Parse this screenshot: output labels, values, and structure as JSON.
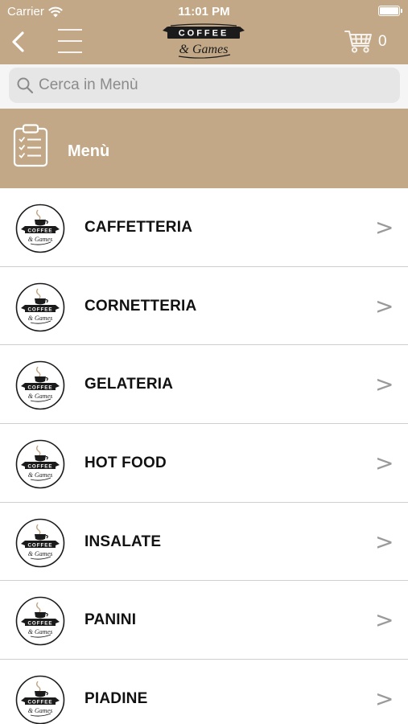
{
  "status_bar": {
    "carrier": "Carrier",
    "time": "11:01 PM",
    "battery_level": 1.0
  },
  "nav": {
    "back_icon": "chevron-left-icon",
    "menu_icon": "hamburger-icon",
    "logo": {
      "line1": "COFFEE",
      "line2": "& Games"
    },
    "cart_icon": "cart-icon",
    "cart_count": "0"
  },
  "search": {
    "placeholder": "Cerca in Menù",
    "value": "",
    "icon": "search-icon"
  },
  "section": {
    "icon": "clipboard-checklist-icon",
    "title": "Menù"
  },
  "categories": [
    {
      "label": "CAFFETTERIA",
      "chevron": ">"
    },
    {
      "label": "CORNETTERIA",
      "chevron": ">"
    },
    {
      "label": "GELATERIA",
      "chevron": ">"
    },
    {
      "label": "HOT FOOD",
      "chevron": ">"
    },
    {
      "label": "INSALATE",
      "chevron": ">"
    },
    {
      "label": "PANINI",
      "chevron": ">"
    },
    {
      "label": "PIADINE",
      "chevron": ">"
    }
  ],
  "colors": {
    "brand_tan": "#c2a887",
    "row_divider": "#cfcfcf",
    "chevron": "#9a9a9a"
  }
}
